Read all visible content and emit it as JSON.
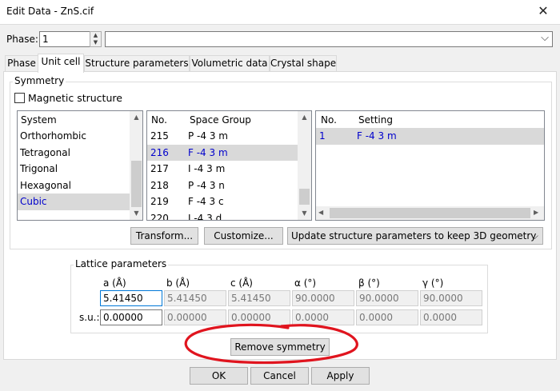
{
  "window": {
    "title": "Edit Data - ZnS.cif",
    "close_glyph": "✕"
  },
  "phase": {
    "label": "Phase:",
    "value": "1",
    "name_value": ""
  },
  "tabs": [
    "Phase",
    "Unit cell",
    "Structure parameters",
    "Volumetric data",
    "Crystal shape"
  ],
  "active_tab": "Unit cell",
  "symmetry": {
    "group_label": "Symmetry",
    "magnetic_label": "Magnetic structure",
    "magnetic_checked": false,
    "system_header": "System",
    "systems": [
      "Orthorhombic",
      "Tetragonal",
      "Trigonal",
      "Hexagonal",
      "Cubic"
    ],
    "selected_system": "Cubic",
    "sg_headers": {
      "no": "No.",
      "name": "Space Group"
    },
    "space_groups": [
      {
        "no": "215",
        "name": "P -4 3 m"
      },
      {
        "no": "216",
        "name": "F -4 3 m"
      },
      {
        "no": "217",
        "name": "I -4 3 m"
      },
      {
        "no": "218",
        "name": "P -4 3 n"
      },
      {
        "no": "219",
        "name": "F -4 3 c"
      },
      {
        "no": "220",
        "name": "I -4 3 d"
      }
    ],
    "selected_space_group": "216",
    "setting_headers": {
      "no": "No.",
      "setting": "Setting"
    },
    "settings": [
      {
        "no": "1",
        "setting": "F -4 3 m"
      }
    ],
    "transform_button": "Transform...",
    "customize_button": "Customize...",
    "update_option": "Update structure parameters to keep 3D geometry"
  },
  "lattice": {
    "group_label": "Lattice parameters",
    "headers": [
      "a (Å)",
      "b (Å)",
      "c (Å)",
      "α (°)",
      "β (°)",
      "γ (°)"
    ],
    "values": [
      "5.41450",
      "5.41450",
      "5.41450",
      "90.0000",
      "90.0000",
      "90.0000"
    ],
    "su_label": "s.u.:",
    "su_values": [
      "0.00000",
      "0.00000",
      "0.00000",
      "0.0000",
      "0.0000",
      "0.0000"
    ],
    "remove_symmetry_button": "Remove symmetry"
  },
  "buttons": {
    "ok": "OK",
    "cancel": "Cancel",
    "apply": "Apply"
  },
  "annotation_color": "#e0141e"
}
